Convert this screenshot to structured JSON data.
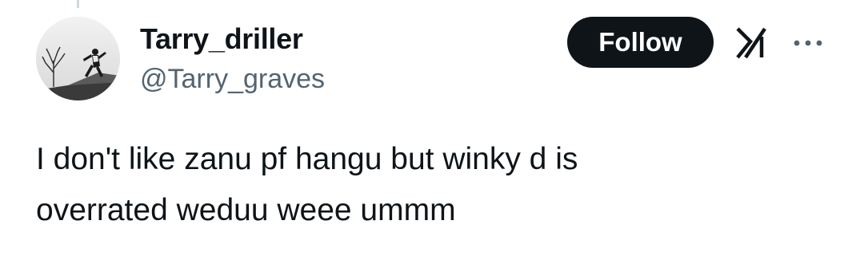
{
  "tweet": {
    "display_name": "Tarry_driller",
    "handle": "@Tarry_graves",
    "text": "I don't like zanu pf hangu but winky d is\noverrated weduu weee ummm"
  },
  "actions": {
    "follow_label": "Follow",
    "grok_icon": "grok-icon",
    "more_icon": "more-options-icon"
  },
  "colors": {
    "text_primary": "#0f1419",
    "text_secondary": "#536471",
    "button_bg": "#0f1419",
    "button_text": "#ffffff",
    "thread_line": "#cfd9de"
  }
}
